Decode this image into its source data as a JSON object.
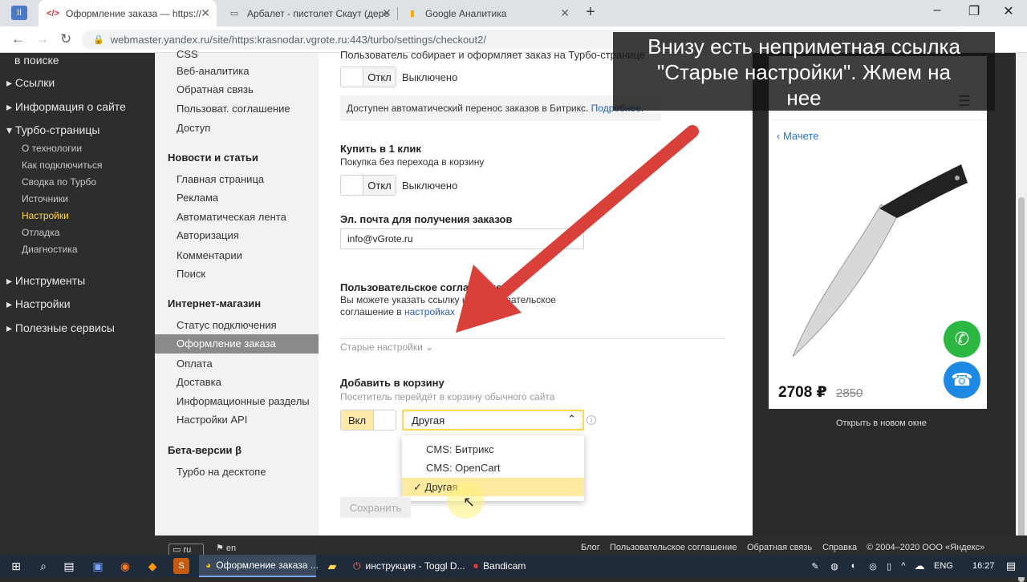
{
  "tabs": [
    {
      "title": "Оформление заказа — https://"
    },
    {
      "title": "Арбалет - пистолет Скаут (дере"
    },
    {
      "title": "Google Аналитика"
    }
  ],
  "address": {
    "url": "webmaster.yandex.ru/site/https:krasnodar.vgrote.ru:443/turbo/settings/checkout2/"
  },
  "caption": {
    "line1": "Внизу есть неприметная ссылка",
    "line2": "\"Старые настройки\". Жмем на",
    "line3": "нее"
  },
  "sidebar": {
    "top_text": "в поиске",
    "items": [
      "Ссылки",
      "Информация о сайте",
      "Турбо-страницы"
    ],
    "turbo_sub": [
      "О технологии",
      "Как подключиться",
      "Сводка по Турбо",
      "Источники",
      "Настройки",
      "Отладка",
      "Диагностика"
    ],
    "items2": [
      "Инструменты",
      "Настройки",
      "Полезные сервисы"
    ]
  },
  "nav2": {
    "top_cut": "CSS",
    "group1": [
      "Веб-аналитика",
      "Обратная связь",
      "Пользоват. соглашение",
      "Доступ"
    ],
    "head_news": "Новости и статьи",
    "group2": [
      "Главная страница",
      "Реклама",
      "Автоматическая лента",
      "Авторизация",
      "Комментарии",
      "Поиск"
    ],
    "head_shop": "Интернет-магазин",
    "group3": [
      "Статус подключения",
      "Оформление заказа",
      "Оплата",
      "Доставка",
      "Информационные разделы",
      "Настройки API"
    ],
    "head_beta": "Бета-версии β",
    "group4": [
      "Турбо на десктопе"
    ]
  },
  "main": {
    "top_cut": "Пользователь собирает и оформляет заказ на Турбо-странице",
    "toggle_off": "Откл",
    "status_off": "Выключено",
    "notice": "Доступен автоматический перенос заказов в Битрикс.",
    "notice_link": "Подробнее.",
    "buy1_title": "Купить в 1 клик",
    "buy1_desc": "Покупка без перехода в корзину",
    "email_title": "Эл. почта для получения заказов",
    "email_value": "info@vGrote.ru",
    "agreement_title": "Пользовательское соглашение",
    "agreement_desc1": "Вы можете указать ссылку на пользовательское",
    "agreement_desc2": "соглашение в",
    "agreement_link": "настройках",
    "old_settings": "Старые настройки",
    "cart_title": "Добавить в корзину",
    "cart_desc": "Посетитель перейдёт в корзину обычного сайта",
    "toggle_on": "Вкл",
    "select_value": "Другая",
    "options": [
      "CMS: Битрикс",
      "CMS: OpenCart",
      "Другая"
    ],
    "save": "Сохранить"
  },
  "preview": {
    "back": "Мачете",
    "price": "2708 ₽",
    "old_price": "2850",
    "open_new": "Открыть в новом окне"
  },
  "footer": {
    "lang_ru": "ru",
    "lang_en": "en",
    "links": [
      "Блог",
      "Пользовательское соглашение",
      "Обратная связь",
      "Справка",
      "© 2004–2020 ООО «Яндекс»"
    ]
  },
  "taskbar": {
    "apps": [
      "Оформление заказа ...",
      "инструкция - Toggl D...",
      "Bandicam"
    ],
    "lang": "ENG",
    "time": "16:27"
  },
  "colors": {
    "accent": "#ffd84d",
    "arrow": "#d9403a",
    "whatsapp": "#2cb742",
    "phone": "#1e88e5"
  }
}
